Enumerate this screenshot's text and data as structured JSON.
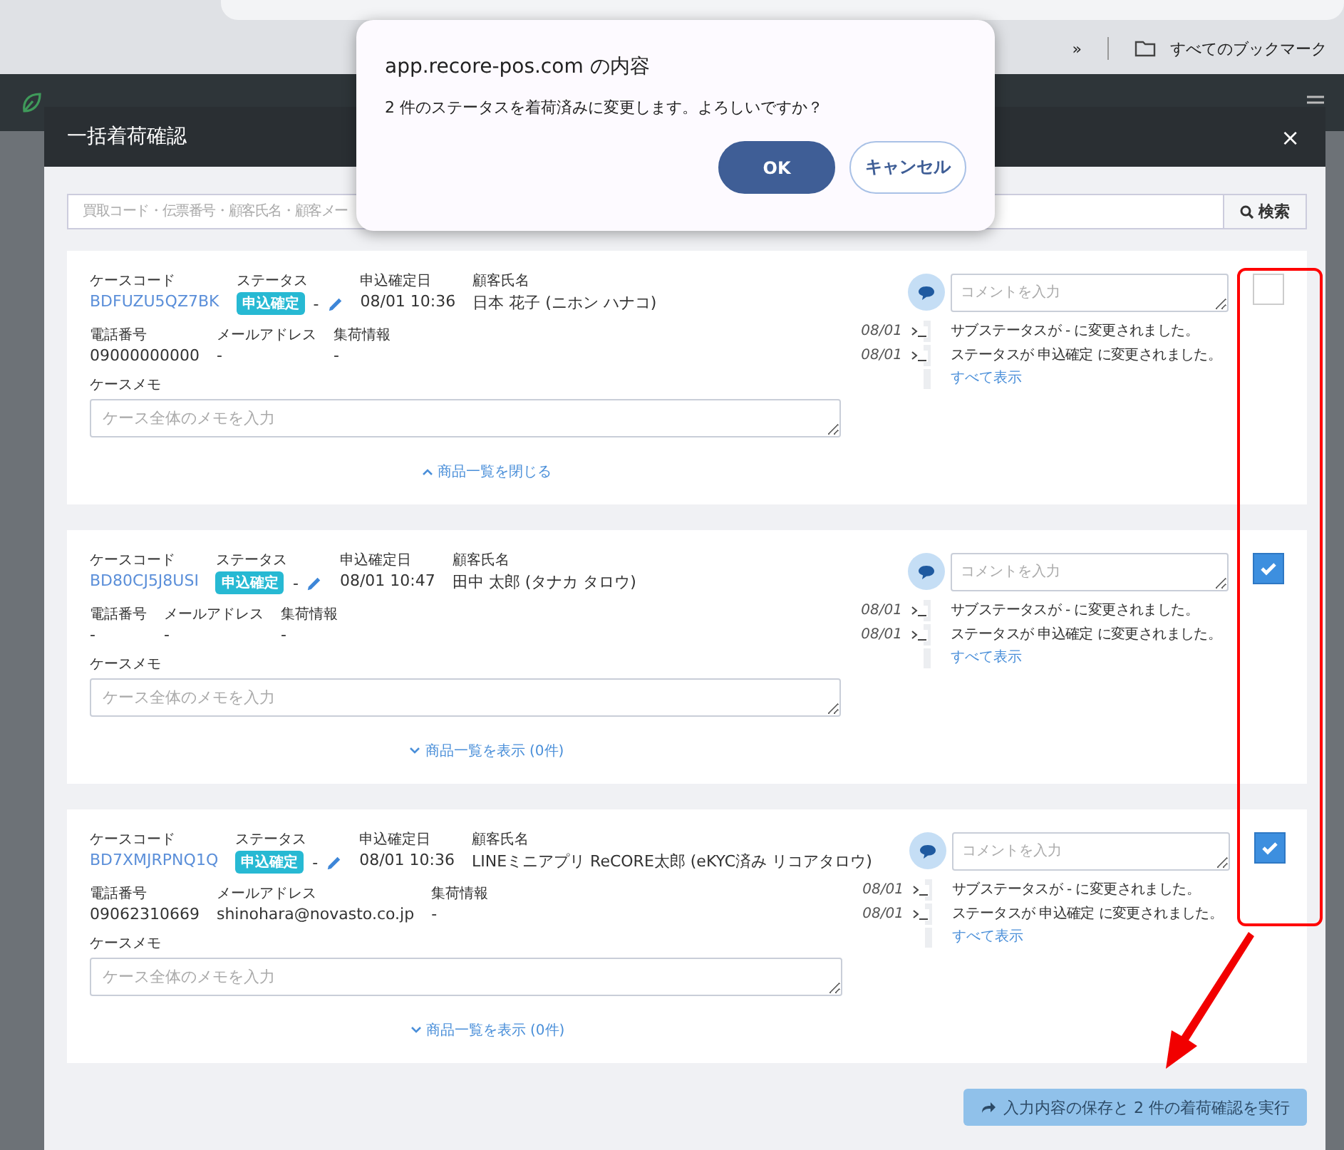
{
  "browser": {
    "overflow": "»",
    "bookmarks_label": "すべてのブックマーク"
  },
  "modal": {
    "title": "一括着荷確認",
    "close": "×"
  },
  "search": {
    "placeholder": "買取コード・伝票番号・顧客氏名・顧客メー",
    "button": "検索"
  },
  "cards": [
    {
      "code_label": "ケースコード",
      "code": "BDFUZU5QZ7BK",
      "status_label": "ステータス",
      "status": "申込確定",
      "substatus": "-",
      "date_label": "申込確定日",
      "date": "08/01 10:36",
      "name_label": "顧客氏名",
      "name": "日本 花子 (ニホン ハナコ)",
      "contacts": [
        {
          "label": "電話番号",
          "value": "09000000000"
        },
        {
          "label": "メールアドレス",
          "value": "-"
        },
        {
          "label": "集荷情報",
          "value": "-"
        }
      ],
      "memo_label": "ケースメモ",
      "memo_placeholder": "ケース全体のメモを入力",
      "toggle": "商品一覧を閉じる",
      "expanded": true,
      "comment_placeholder": "コメントを入力",
      "history": [
        {
          "date": "08/01",
          "text": "サブステータスが - に変更されました。"
        },
        {
          "date": "08/01",
          "text": "ステータスが 申込確定 に変更されました。"
        }
      ],
      "show_all": "すべて表示",
      "checked": false
    },
    {
      "code_label": "ケースコード",
      "code": "BD80CJ5J8USI",
      "status_label": "ステータス",
      "status": "申込確定",
      "substatus": "-",
      "date_label": "申込確定日",
      "date": "08/01 10:47",
      "name_label": "顧客氏名",
      "name": "田中 太郎 (タナカ タロウ)",
      "contacts": [
        {
          "label": "電話番号",
          "value": "-"
        },
        {
          "label": "メールアドレス",
          "value": "-"
        },
        {
          "label": "集荷情報",
          "value": "-"
        }
      ],
      "memo_label": "ケースメモ",
      "memo_placeholder": "ケース全体のメモを入力",
      "toggle": "商品一覧を表示 (0件)",
      "expanded": false,
      "comment_placeholder": "コメントを入力",
      "history": [
        {
          "date": "08/01",
          "text": "サブステータスが - に変更されました。"
        },
        {
          "date": "08/01",
          "text": "ステータスが 申込確定 に変更されました。"
        }
      ],
      "show_all": "すべて表示",
      "checked": true
    },
    {
      "code_label": "ケースコード",
      "code": "BD7XMJRPNQ1Q",
      "status_label": "ステータス",
      "status": "申込確定",
      "substatus": "-",
      "date_label": "申込確定日",
      "date": "08/01 10:36",
      "name_label": "顧客氏名",
      "name": "LINEミニアプリ ReCORE太郎 (eKYC済み リコアタロウ)",
      "contacts": [
        {
          "label": "電話番号",
          "value": "09062310669"
        },
        {
          "label": "メールアドレス",
          "value": "shinohara@novasto.co.jp"
        },
        {
          "label": "集荷情報",
          "value": "-"
        }
      ],
      "memo_label": "ケースメモ",
      "memo_placeholder": "ケース全体のメモを入力",
      "toggle": "商品一覧を表示 (0件)",
      "expanded": false,
      "comment_placeholder": "コメントを入力",
      "history": [
        {
          "date": "08/01",
          "text": "サブステータスが - に変更されました。"
        },
        {
          "date": "08/01",
          "text": "ステータスが 申込確定 に変更されました。"
        }
      ],
      "show_all": "すべて表示",
      "checked": true
    }
  ],
  "submit": "入力内容の保存と 2 件の着荷確認を実行",
  "alert": {
    "origin": "app.recore-pos.com の内容",
    "message": "2 件のステータスを着荷済みに変更します。よろしいですか？",
    "buttons": [
      {
        "label": "OK",
        "kind": "primary"
      },
      {
        "label": "キャンセル",
        "kind": "secondary"
      }
    ]
  }
}
